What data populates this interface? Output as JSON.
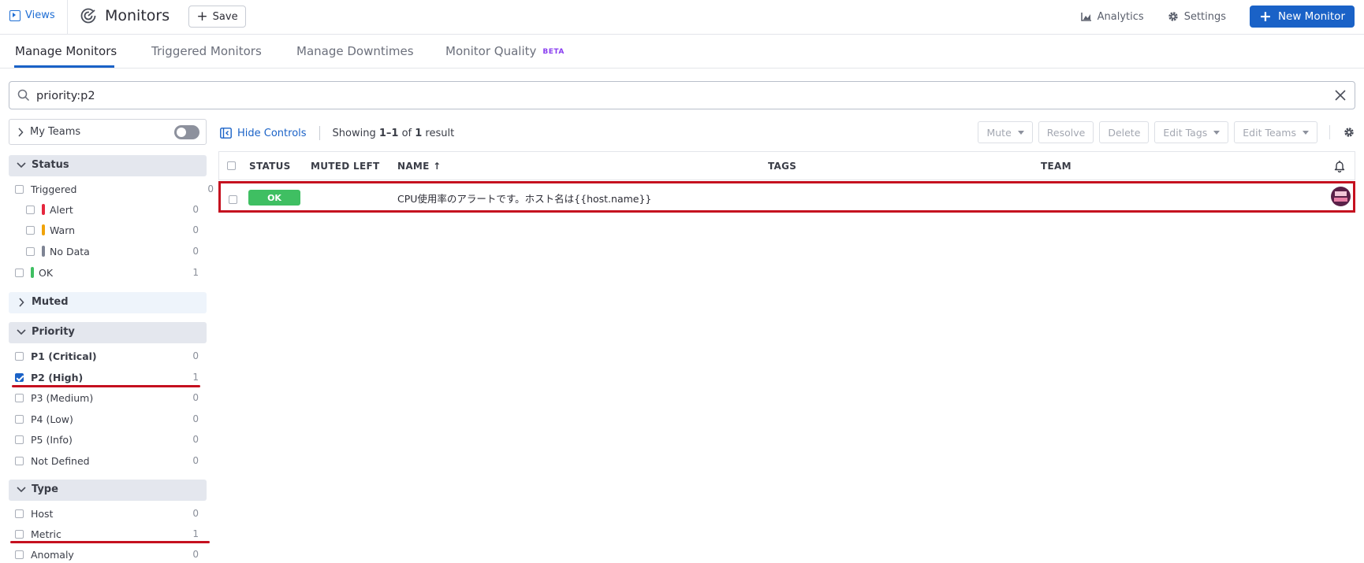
{
  "topbar": {
    "views_label": "Views",
    "title": "Monitors",
    "save_label": "Save",
    "analytics_label": "Analytics",
    "settings_label": "Settings",
    "new_monitor_label": "New Monitor"
  },
  "tabs": [
    {
      "label": "Manage Monitors",
      "active": true
    },
    {
      "label": "Triggered Monitors"
    },
    {
      "label": "Manage Downtimes"
    },
    {
      "label": "Monitor Quality",
      "badge": "BETA"
    }
  ],
  "search": {
    "value": "priority:p2"
  },
  "sidebar": {
    "my_teams_label": "My Teams",
    "status": {
      "title": "Status",
      "items": [
        {
          "label": "Triggered",
          "count": "0"
        },
        {
          "label": "Alert",
          "count": "0",
          "color": "#e5273e"
        },
        {
          "label": "Warn",
          "count": "0",
          "color": "#f0a30a"
        },
        {
          "label": "No Data",
          "count": "0",
          "color": "#7e8494"
        },
        {
          "label": "OK",
          "count": "1",
          "color": "#3fbf62"
        }
      ]
    },
    "muted": {
      "title": "Muted"
    },
    "priority": {
      "title": "Priority",
      "items": [
        {
          "label": "P1 (Critical)",
          "count": "0"
        },
        {
          "label": "P2 (High)",
          "count": "1",
          "checked": true
        },
        {
          "label": "P3 (Medium)",
          "count": "0"
        },
        {
          "label": "P4 (Low)",
          "count": "0"
        },
        {
          "label": "P5 (Info)",
          "count": "0"
        },
        {
          "label": "Not Defined",
          "count": "0"
        }
      ]
    },
    "type": {
      "title": "Type",
      "items": [
        {
          "label": "Host",
          "count": "0"
        },
        {
          "label": "Metric",
          "count": "1"
        },
        {
          "label": "Anomaly",
          "count": "0"
        }
      ]
    }
  },
  "list": {
    "hide_controls_label": "Hide Controls",
    "showing_prefix": "Showing ",
    "showing_range": "1–1",
    "showing_of": " of ",
    "showing_total": "1",
    "showing_suffix": " result",
    "actions": {
      "mute": "Mute",
      "resolve": "Resolve",
      "delete": "Delete",
      "edit_tags": "Edit Tags",
      "edit_teams": "Edit Teams"
    },
    "columns": {
      "status": "STATUS",
      "muted_left": "MUTED LEFT",
      "name": "NAME ↑",
      "tags": "TAGS",
      "team": "TEAM"
    },
    "rows": [
      {
        "status": "OK",
        "name": "CPU使用率のアラートです。ホスト名は{{host.name}}"
      }
    ]
  }
}
